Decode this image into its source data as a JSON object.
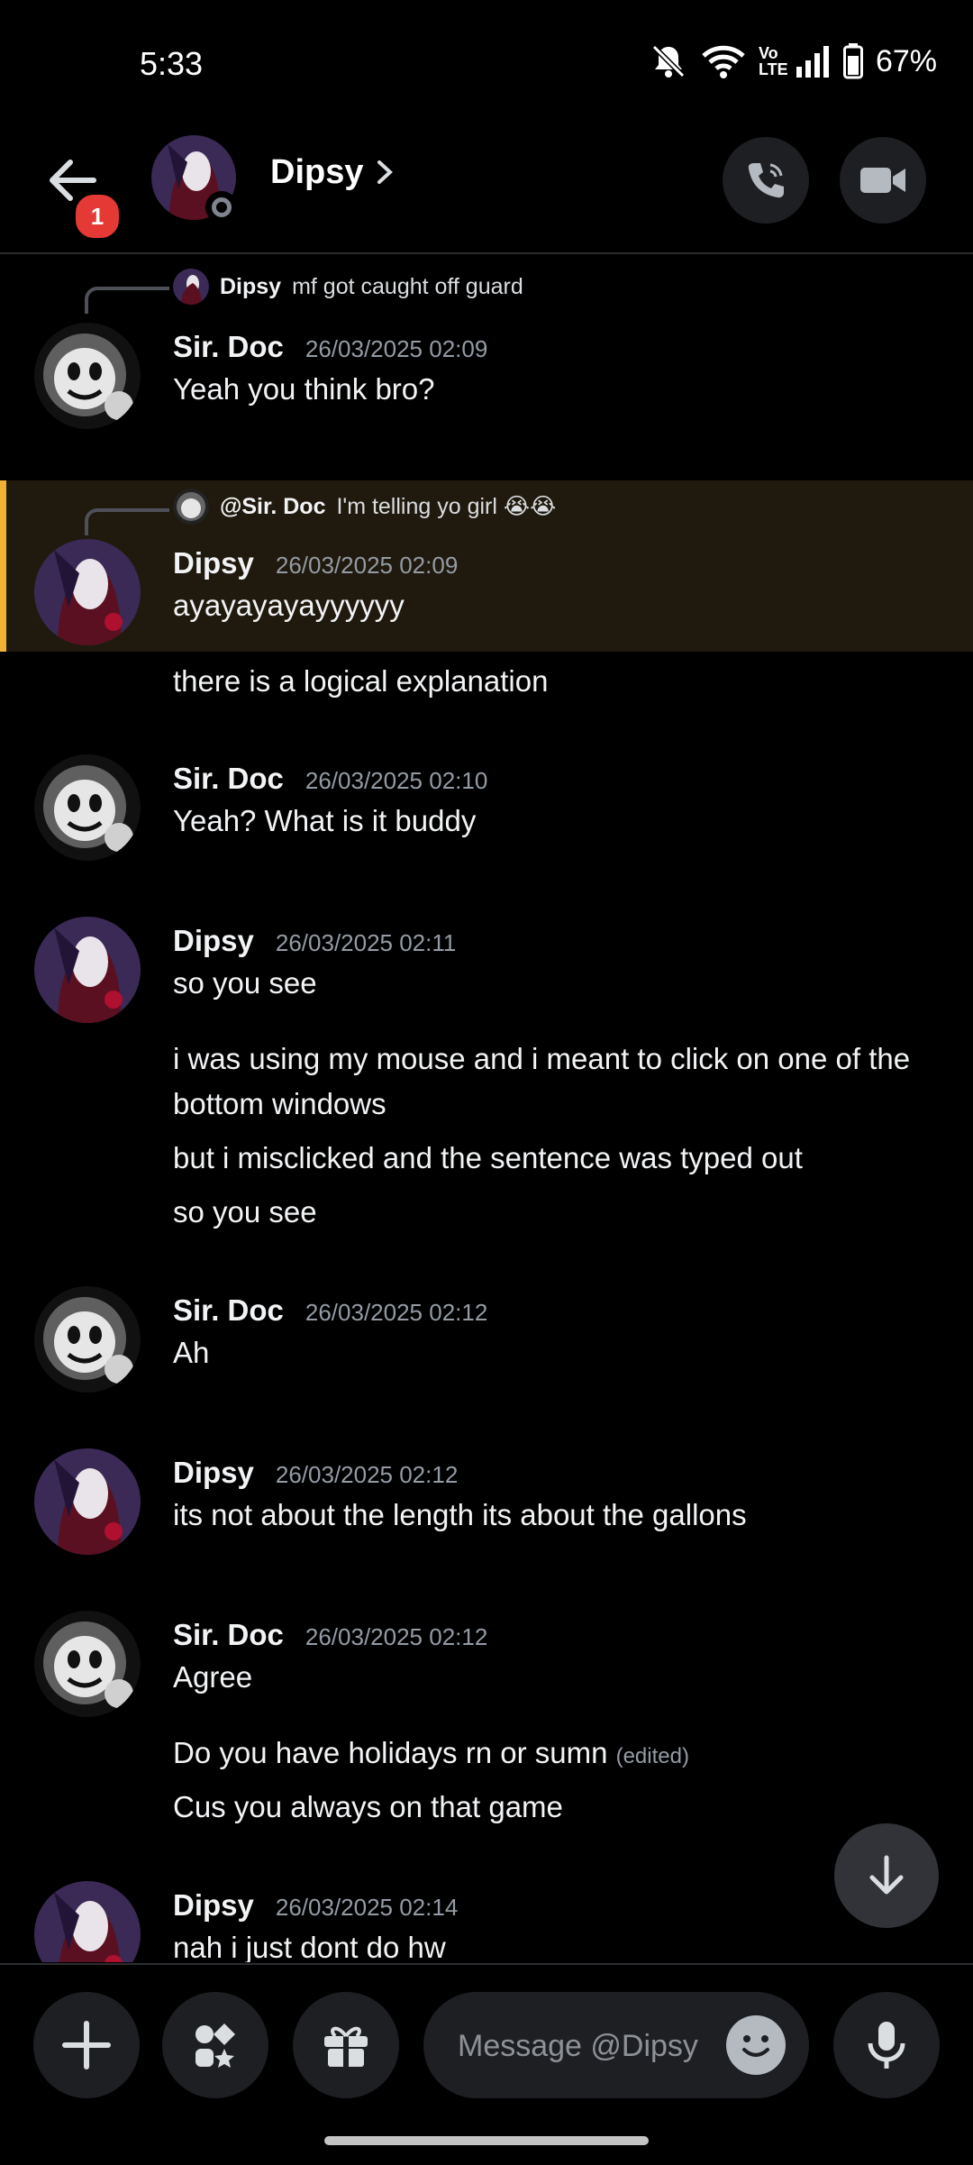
{
  "status_bar": {
    "time": "5:33",
    "battery": "67%",
    "network_label": "Vo LTE"
  },
  "header": {
    "title": "Dipsy",
    "notification_count": "1"
  },
  "messages": [
    {
      "type": "reply",
      "reply_to": {
        "author": "Dipsy",
        "text": "mf got caught off guard"
      },
      "author": "Sir. Doc",
      "timestamp": "26/03/2025 02:09",
      "lines": [
        "Yeah you think bro?"
      ]
    },
    {
      "type": "reply",
      "highlighted": true,
      "reply_to": {
        "author": "@Sir. Doc",
        "text": "I'm telling yo girl 😭😭"
      },
      "author": "Dipsy",
      "timestamp": "26/03/2025 02:09",
      "lines": [
        "ayayayayayyyyyy",
        "there is a logical explanation"
      ]
    },
    {
      "author": "Sir. Doc",
      "timestamp": "26/03/2025 02:10",
      "lines": [
        "Yeah? What is it buddy"
      ]
    },
    {
      "author": "Dipsy",
      "timestamp": "26/03/2025 02:11",
      "lines": [
        "so you see",
        "i was using my mouse and i meant to click on one of the bottom windows",
        "but i misclicked and the sentence was typed out",
        "so you see"
      ]
    },
    {
      "author": "Sir. Doc",
      "timestamp": "26/03/2025 02:12",
      "lines": [
        "Ah"
      ]
    },
    {
      "author": "Dipsy",
      "timestamp": "26/03/2025 02:12",
      "lines": [
        "its not about the length its about the gallons"
      ]
    },
    {
      "author": "Sir. Doc",
      "timestamp": "26/03/2025 02:12",
      "lines": [
        "Agree",
        "Do you have holidays rn or sumn",
        "Cus you always on that game"
      ],
      "edited_label": "(edited)"
    },
    {
      "author": "Dipsy",
      "timestamp": "26/03/2025 02:14",
      "lines": [
        "nah i just dont do hw"
      ]
    }
  ],
  "composer": {
    "placeholder": "Message @Dipsy"
  },
  "icons": {
    "back": "arrow-left-icon",
    "call": "phone-icon",
    "video": "video-camera-icon",
    "add": "plus-icon",
    "apps": "apps-icon",
    "gift": "gift-icon",
    "emoji": "emoji-icon",
    "mic": "microphone-icon",
    "scroll": "arrow-down-icon"
  },
  "colors": {
    "background": "#000000",
    "highlight_border": "#f0b232",
    "badge": "#e53935"
  }
}
